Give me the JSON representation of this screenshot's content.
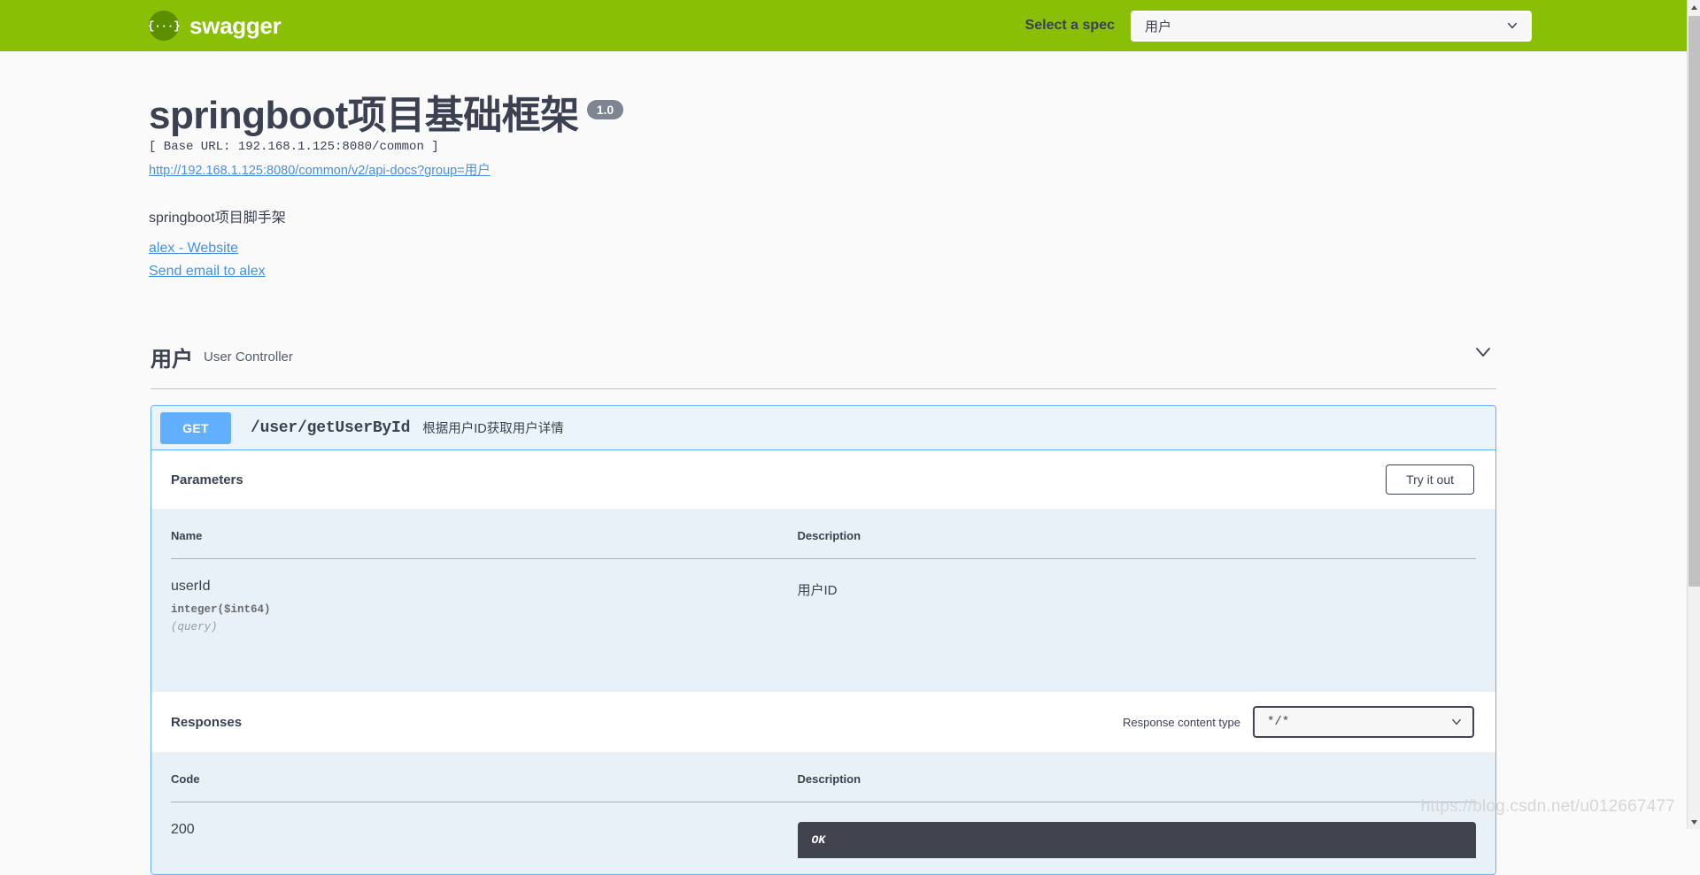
{
  "topbar": {
    "logo_glyph": "{···}",
    "brand_name": "swagger",
    "spec_label": "Select a spec",
    "spec_selected": "用户",
    "spec_options": [
      "用户"
    ],
    "bar_color": "#89bf04"
  },
  "info": {
    "title": "springboot项目基础框架",
    "version": "1.0",
    "base_url": "[ Base URL: 192.168.1.125:8080/common ]",
    "api_docs_link": "http://192.168.1.125:8080/common/v2/api-docs?group=用户",
    "description": "springboot项目脚手架",
    "website_link": "alex - Website",
    "email_link": "Send email to alex"
  },
  "tag": {
    "name": "用户",
    "description": "User Controller"
  },
  "operation": {
    "method": "GET",
    "method_color": "#61affe",
    "path": "/user/getUserById",
    "summary": "根据用户ID获取用户详情",
    "parameters_title": "Parameters",
    "try_it_out_label": "Try it out",
    "param_columns": [
      "Name",
      "Description"
    ],
    "parameters": [
      {
        "name": "userId",
        "type": "integer($int64)",
        "in": "(query)",
        "description": "用户ID"
      }
    ],
    "responses_title": "Responses",
    "response_content_type_label": "Response content type",
    "response_content_type_value": "*/*",
    "response_content_type_options": [
      "*/*"
    ],
    "response_columns": [
      "Code",
      "Description"
    ],
    "responses": [
      {
        "code": "200",
        "description": "OK"
      }
    ]
  },
  "watermark": "https://blog.csdn.net/u012667477"
}
